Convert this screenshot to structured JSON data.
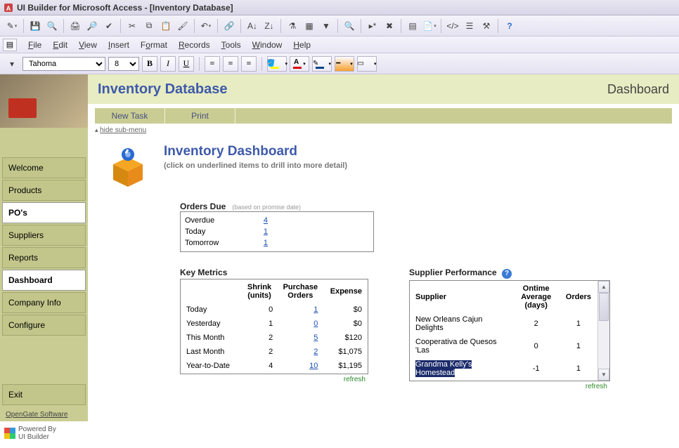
{
  "window": {
    "title": "UI Builder for Microsoft Access - [Inventory Database]"
  },
  "menu": {
    "file": "File",
    "edit": "Edit",
    "view": "View",
    "insert": "Insert",
    "format": "Format",
    "records": "Records",
    "tools": "Tools",
    "window": "Window",
    "help": "Help"
  },
  "format_toolbar": {
    "font": "Tahoma",
    "size": "8"
  },
  "sidebar": {
    "items": [
      {
        "label": "Welcome"
      },
      {
        "label": "Products"
      },
      {
        "label": "PO's"
      },
      {
        "label": "Suppliers"
      },
      {
        "label": "Reports"
      },
      {
        "label": "Dashboard"
      },
      {
        "label": "Company Info"
      },
      {
        "label": "Configure"
      }
    ],
    "exit": "Exit",
    "footer_link": "OpenGate Software",
    "powered1": "Powered By",
    "powered2": "UI Builder"
  },
  "header": {
    "title": "Inventory Database",
    "right": "Dashboard"
  },
  "subbar": {
    "newtask": "New Task",
    "print": "Print",
    "hide": "hide sub-menu"
  },
  "dashboard": {
    "title": "Inventory Dashboard",
    "subtitle": "(click on underlined items to drill into more detail)",
    "orders_due": {
      "title": "Orders Due",
      "note": "(based on promise date)",
      "rows": [
        {
          "label": "Overdue",
          "value": "4"
        },
        {
          "label": "Today",
          "value": "1"
        },
        {
          "label": "Tomorrow",
          "value": "1"
        }
      ]
    },
    "key_metrics": {
      "title": "Key Metrics",
      "headers": {
        "c0": "",
        "c1": "Shrink (units)",
        "c2": "Purchase Orders",
        "c3": "Expense"
      },
      "rows": [
        {
          "label": "Today",
          "shrink": "0",
          "po": "1",
          "exp": "$0"
        },
        {
          "label": "Yesterday",
          "shrink": "1",
          "po": "0",
          "exp": "$0"
        },
        {
          "label": "This Month",
          "shrink": "2",
          "po": "5",
          "exp": "$120"
        },
        {
          "label": "Last Month",
          "shrink": "2",
          "po": "2",
          "exp": "$1,075"
        },
        {
          "label": "Year-to-Date",
          "shrink": "4",
          "po": "10",
          "exp": "$1,195"
        }
      ],
      "refresh": "refresh"
    },
    "supplier_perf": {
      "title": "Supplier Performance",
      "headers": {
        "c0": "Supplier",
        "c1": "Ontime Average (days)",
        "c2": "Orders"
      },
      "rows": [
        {
          "supplier": "New Orleans Cajun Delights",
          "avg": "2",
          "orders": "1"
        },
        {
          "supplier": "Cooperativa de Quesos 'Las",
          "avg": "0",
          "orders": "1"
        },
        {
          "supplier": "Grandma Kelly's Homestead",
          "avg": "-1",
          "orders": "1"
        }
      ],
      "refresh": "refresh"
    }
  }
}
